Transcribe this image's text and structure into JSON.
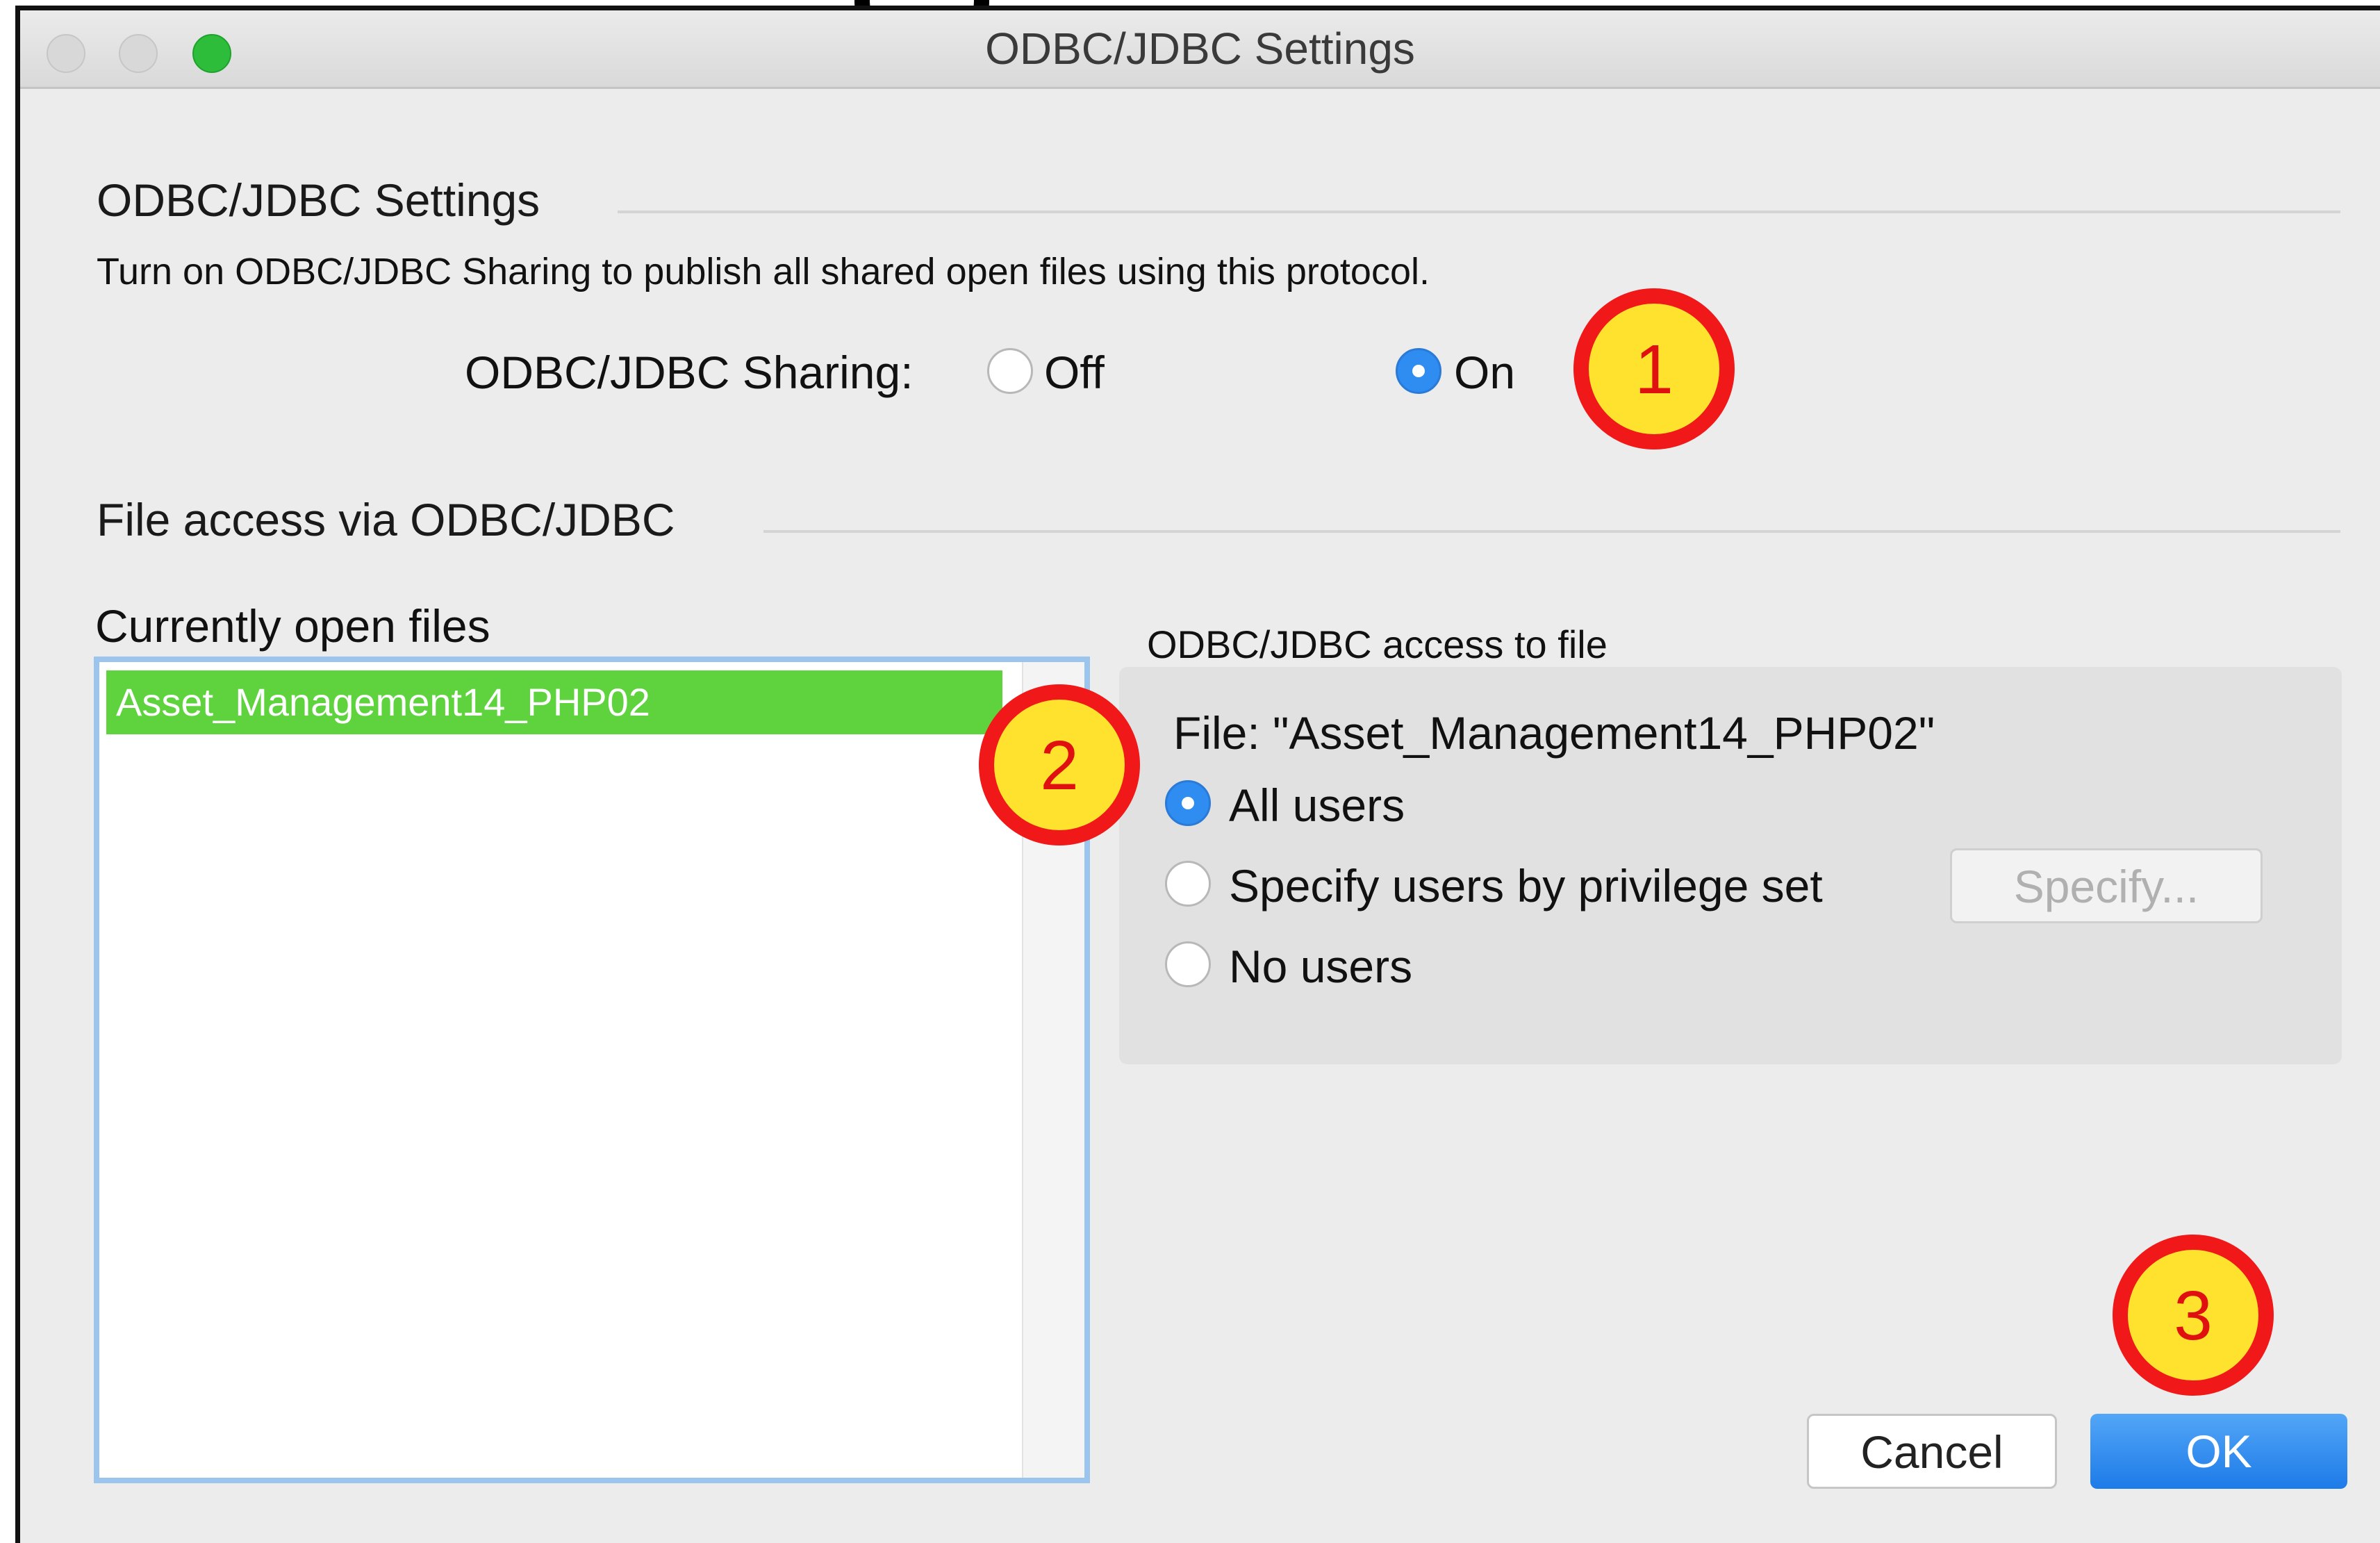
{
  "window": {
    "title": "ODBC/JDBC Settings"
  },
  "sharing_section": {
    "title": "ODBC/JDBC Settings",
    "description": "Turn on ODBC/JDBC Sharing to publish all shared open files using this protocol.",
    "sharing_label": "ODBC/JDBC Sharing:",
    "options": [
      {
        "label": "Off",
        "selected": false
      },
      {
        "label": "On",
        "selected": true
      }
    ]
  },
  "file_access_section": {
    "title": "File access via ODBC/JDBC",
    "list_title": "Currently open files",
    "files": [
      {
        "name": "Asset_Management14_PHP02",
        "selected": true
      }
    ]
  },
  "access_group": {
    "label": "ODBC/JDBC access to file",
    "file_label": "File: \"Asset_Management14_PHP02\"",
    "options": [
      {
        "label": "All users",
        "selected": true
      },
      {
        "label": "Specify users by privilege set",
        "selected": false
      },
      {
        "label": "No users",
        "selected": false
      }
    ],
    "specify_button": "Specify..."
  },
  "buttons": {
    "cancel": "Cancel",
    "ok": "OK"
  },
  "callouts": [
    "1",
    "2",
    "3"
  ],
  "colors": {
    "selection_green": "#5fd33e",
    "radio_blue": "#2f8cf0",
    "callout_fill": "#ffe22e",
    "callout_border": "#f01818",
    "ok_button": "#1d7be8"
  }
}
